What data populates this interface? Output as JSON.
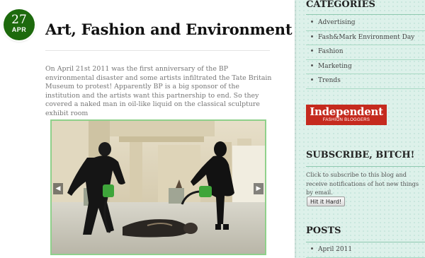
{
  "post": {
    "date_day": "27",
    "date_month": "APR",
    "title": "Art, Fashion and Environment",
    "body": "On April 21st 2011 was the first anniversary of the BP environmental disaster and some artists infiltrated the Tate Britain Museum to protest! Apparently BP is a big sponsor of the institution and the artists want this partnership to end. So they covered a naked man in oil-like liquid on the classical sculpture exhibit room"
  },
  "photo": {
    "prev_arrow": "◀",
    "next_arrow": "▶"
  },
  "sidebar": {
    "categories_title": "CATEGORIES",
    "categories": [
      {
        "label": "Advertising"
      },
      {
        "label": "Fash&Mark Environment Day"
      },
      {
        "label": "Fashion"
      },
      {
        "label": "Marketing"
      },
      {
        "label": "Trends"
      }
    ],
    "badge": {
      "main": "Independent",
      "sub": "FASHION BLOGGERS"
    },
    "subscribe_title": "SUBSCRIBE, BITCH!",
    "subscribe_text": "Click to subscribe to this blog and receive notifications of hot new things by email.",
    "subscribe_button": "Hit it Hard!",
    "posts_title": "POSTS",
    "posts": [
      {
        "label": "April 2011"
      }
    ]
  },
  "colors": {
    "accent_green": "#1d6a0d",
    "frame_green": "#8fd08b",
    "badge_red": "#c52a1e",
    "page_background": "#ddf1ea"
  },
  "icons": {
    "bullet": "bullet-icon",
    "prev": "arrow-left-icon",
    "next": "arrow-right-icon"
  }
}
